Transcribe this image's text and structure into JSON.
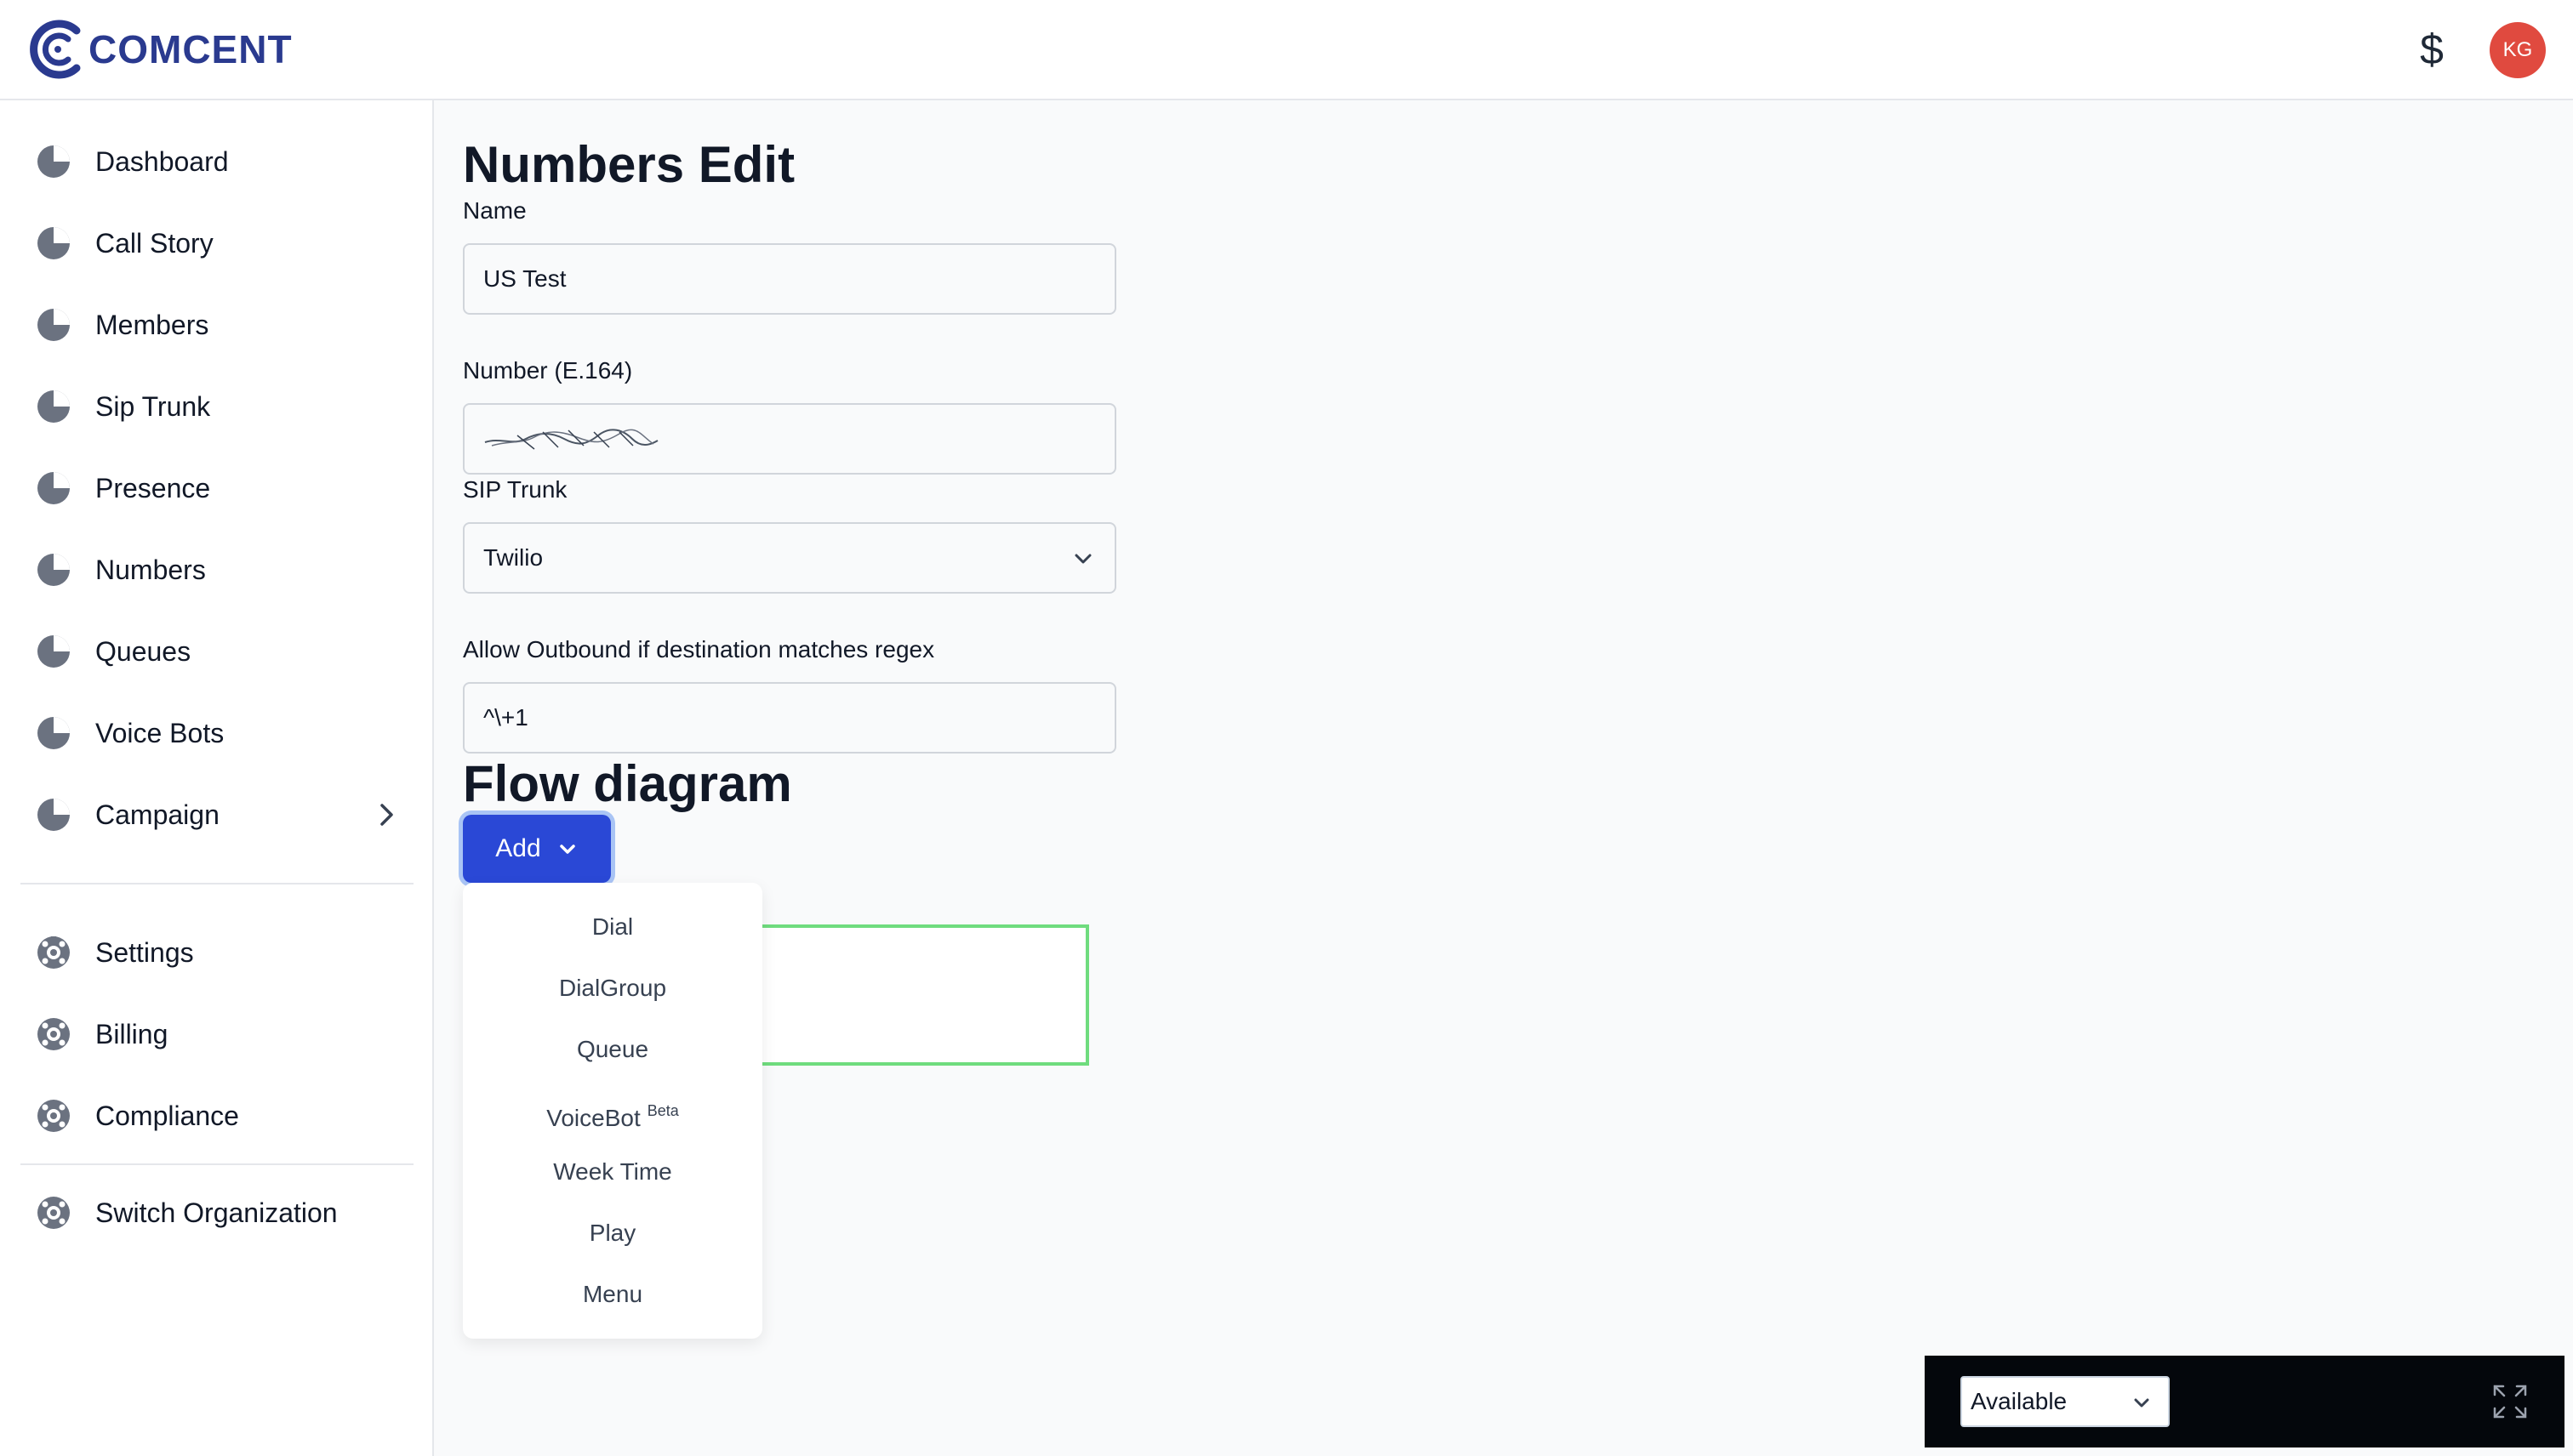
{
  "brand": {
    "name": "COMCENT"
  },
  "header": {
    "currency_symbol": "$",
    "avatar_initials": "KG"
  },
  "sidebar": {
    "items": [
      {
        "label": "Dashboard"
      },
      {
        "label": "Call Story"
      },
      {
        "label": "Members"
      },
      {
        "label": "Sip Trunk"
      },
      {
        "label": "Presence"
      },
      {
        "label": "Numbers"
      },
      {
        "label": "Queues"
      },
      {
        "label": "Voice Bots"
      },
      {
        "label": "Campaign"
      }
    ],
    "settings_items": [
      {
        "label": "Settings"
      },
      {
        "label": "Billing"
      },
      {
        "label": "Compliance"
      }
    ],
    "org_item": {
      "label": "Switch Organization"
    }
  },
  "form": {
    "title": "Numbers Edit",
    "name": {
      "label": "Name",
      "value": "US Test"
    },
    "number": {
      "label": "Number (E.164)"
    },
    "sip_trunk": {
      "label": "SIP Trunk",
      "value": "Twilio"
    },
    "outbound": {
      "label": "Allow Outbound if destination matches regex",
      "value": "^\\+1"
    }
  },
  "flow": {
    "title": "Flow diagram",
    "add_label": "Add",
    "menu": [
      {
        "label": "Dial"
      },
      {
        "label": "DialGroup"
      },
      {
        "label": "Queue"
      },
      {
        "label": "VoiceBot",
        "badge": "Beta"
      },
      {
        "label": "Week Time"
      },
      {
        "label": "Play"
      },
      {
        "label": "Menu"
      }
    ]
  },
  "phone": {
    "status": "Available"
  },
  "colors": {
    "brand": "#2a3a8f",
    "primary_button": "#2a48d6",
    "avatar": "#e04a3f",
    "flow_node_border": "#6fdc7e"
  }
}
